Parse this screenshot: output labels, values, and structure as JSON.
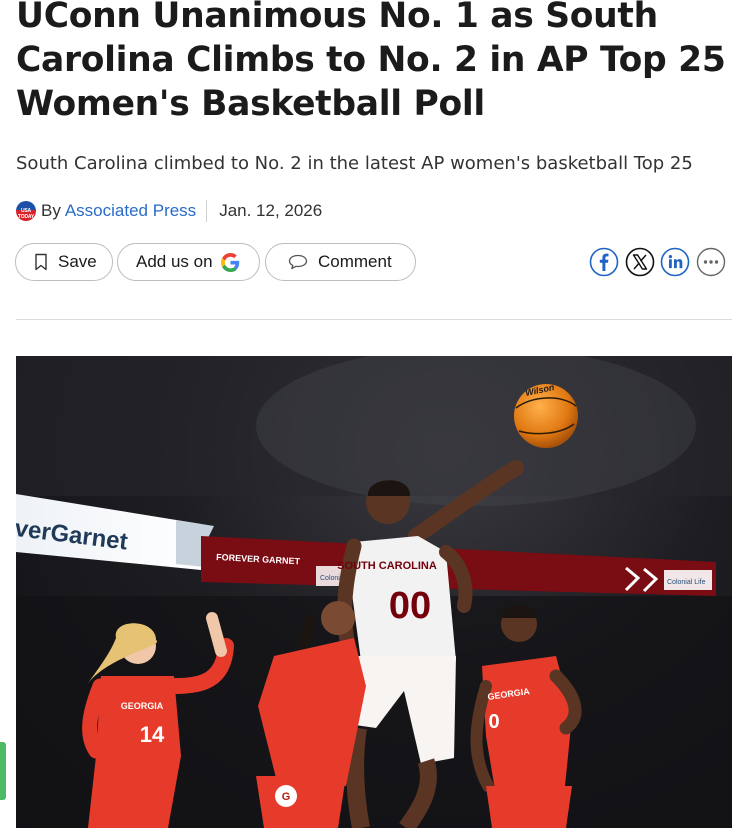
{
  "article": {
    "headline": "UConn Unanimous No. 1 as South Carolina Climbs to No. 2 in AP Top 25 Women's Basketball Poll",
    "subheadline": "South Carolina climbed to No. 2 in the latest AP women's basketball Top 25",
    "byline": {
      "prefix": "By",
      "author": "Associated Press",
      "date": "Jan. 12, 2026",
      "logo_text": "USA TODAY"
    }
  },
  "actions": {
    "save_label": "Save",
    "add_us_label": "Add us on",
    "comment_label": "Comment"
  },
  "share": {
    "icons": [
      "facebook-icon",
      "x-icon",
      "linkedin-icon",
      "more-icon"
    ]
  },
  "hero_image": {
    "signage": {
      "left_banner": "verGarnet",
      "forever_garnet": "FOREVER GARNET",
      "colonial_life": "Colonial Life"
    },
    "players": {
      "main_jersey_text": "SOUTH CAROLINA",
      "main_number": "00",
      "left_jersey_text": "GEORGIA",
      "left_number": "14",
      "right_jersey_text": "GEORGIA",
      "right_number": "0",
      "ball_text": "Wilson"
    }
  },
  "colors": {
    "link": "#2a6bc9",
    "garnet": "#73000a",
    "georgia_red": "#e63a2a",
    "google_blue": "#4285f4",
    "google_red": "#ea4335",
    "google_yellow": "#fbbc05",
    "google_green": "#34a853"
  }
}
